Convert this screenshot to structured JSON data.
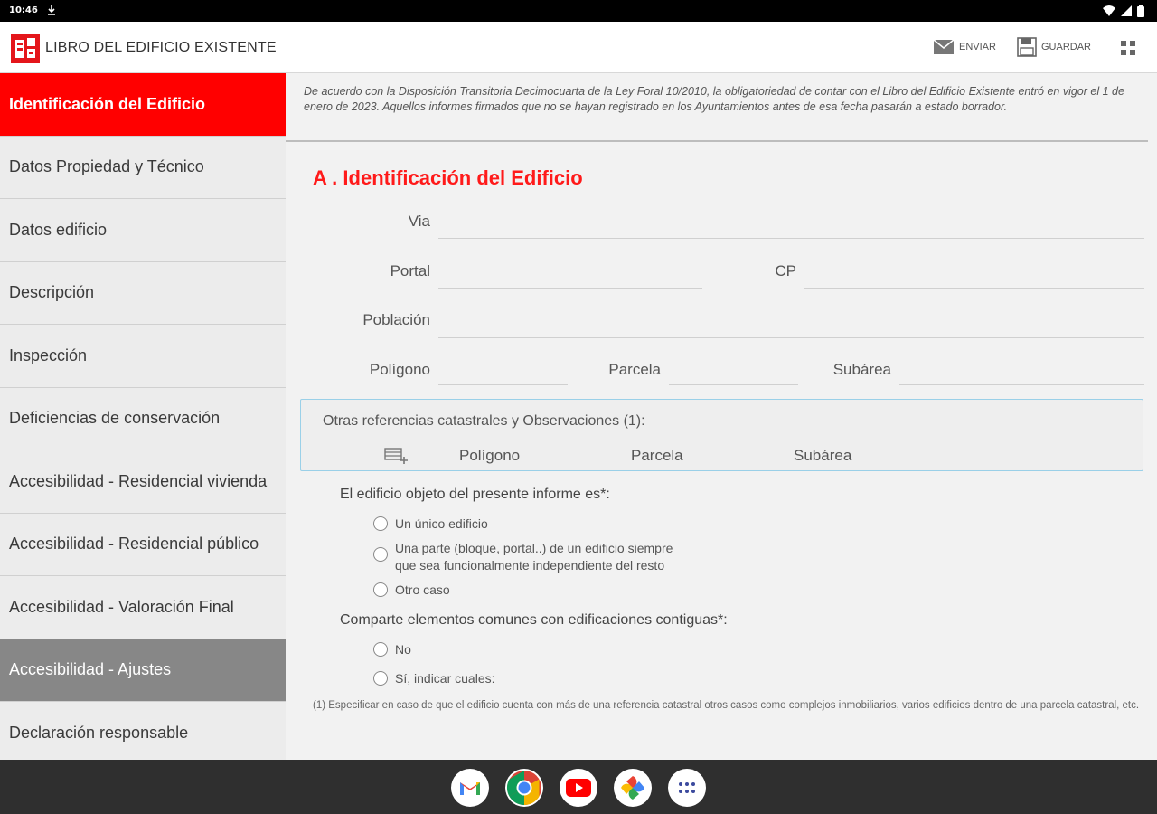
{
  "status_bar": {
    "time": "10:46"
  },
  "app_bar": {
    "title": "LIBRO DEL EDIFICIO EXISTENTE",
    "send_label": "ENVIAR",
    "save_label": "GUARDAR"
  },
  "sidebar": {
    "items": [
      {
        "label": "Identificación del Edificio"
      },
      {
        "label": "Datos Propiedad y Técnico"
      },
      {
        "label": "Datos edificio"
      },
      {
        "label": "Descripción"
      },
      {
        "label": "Inspección"
      },
      {
        "label": "Deficiencias de conservación"
      },
      {
        "label": "Accesibilidad - Residencial vivienda"
      },
      {
        "label": "Accesibilidad - Residencial público"
      },
      {
        "label": "Accesibilidad - Valoración Final"
      },
      {
        "label": "Accesibilidad - Ajustes"
      },
      {
        "label": "Declaración responsable"
      }
    ]
  },
  "content": {
    "notice": "De acuerdo con la Disposición Transitoria Decimocuarta de la Ley Foral 10/2010, la obligatoriedad de contar con el Libro del Edificio Existente entró en vigor el 1 de enero de 2023. Aquellos informes firmados que no se hayan registrado en los Ayuntamientos antes de esa fecha pasarán a estado borrador.",
    "section_title": "A . Identificación del Edificio",
    "fields": {
      "via": "Via",
      "portal": "Portal",
      "cp": "CP",
      "poblacion": "Población",
      "poligono": "Polígono",
      "parcela": "Parcela",
      "subarea": "Subárea"
    },
    "refs": {
      "title": "Otras referencias catastrales y Observaciones (1):",
      "col_poligono": "Polígono",
      "col_parcela": "Parcela",
      "col_subarea": "Subárea"
    },
    "q1": {
      "label": "El edificio objeto del presente informe es*:",
      "opt1": "Un único edificio",
      "opt2_line1": "Una parte (bloque, portal..) de un edificio siempre",
      "opt2_line2": "que sea funcionalmente independiente del resto",
      "opt3": "Otro caso"
    },
    "q2": {
      "label": "Comparte elementos comunes con edificaciones contiguas*:",
      "opt1": "No",
      "opt2": "Sí, indicar cuales:"
    },
    "footnote": "(1) Especificar en caso de que el edificio cuenta con más de una referencia catastral otros casos como complejos inmobiliarios, varios edificios dentro de una parcela catastral, etc."
  },
  "dock": {
    "apps": [
      "gmail-icon",
      "chrome-icon",
      "youtube-icon",
      "photos-icon",
      "app-drawer-icon"
    ]
  },
  "colors": {
    "accent_red": "#ff0000",
    "selected_gray": "#878787",
    "title_red": "#ff1a1a"
  }
}
